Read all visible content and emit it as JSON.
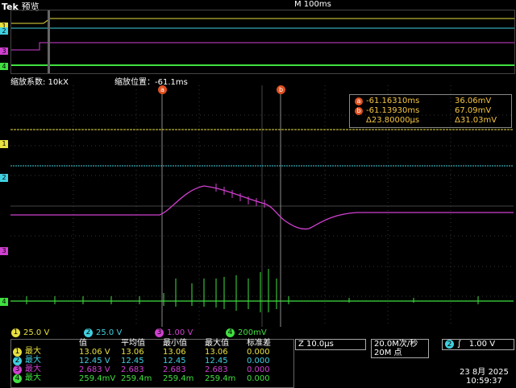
{
  "header": {
    "brand": "Tek",
    "mode": "预览",
    "timebase": "M 100ms"
  },
  "zoom": {
    "factor_label": "缩放系数: 10kX",
    "position_label": "缩放位置：-61.1ms"
  },
  "cursor_readout": {
    "a_time": "-61.16310ms",
    "a_volt": "36.06mV",
    "b_time": "-61.13930ms",
    "b_volt": "67.09mV",
    "delta_time": "Δ23.80000μs",
    "delta_volt": "Δ31.03mV",
    "a_label": "a",
    "b_label": "b"
  },
  "channels": [
    {
      "num": "1",
      "scale": "25.0 V",
      "color": "#e8e040"
    },
    {
      "num": "2",
      "scale": "25.0 V",
      "color": "#40d0e0"
    },
    {
      "num": "3",
      "scale": "1.00 V",
      "color": "#d040d0"
    },
    {
      "num": "4",
      "scale": "200mV",
      "color": "#40e040"
    }
  ],
  "measurements": {
    "headers": [
      "值",
      "平均值",
      "最小值",
      "最大值",
      "标准差"
    ],
    "rows": [
      {
        "ch": "1",
        "label": "最大",
        "value": "13.06 V",
        "mean": "13.06",
        "min": "13.06",
        "max": "13.06",
        "std": "0.000"
      },
      {
        "ch": "2",
        "label": "最大",
        "value": "12.45 V",
        "mean": "12.45",
        "min": "12.45",
        "max": "12.45",
        "std": "0.000"
      },
      {
        "ch": "3",
        "label": "最大",
        "value": "2.683 V",
        "mean": "2.683",
        "min": "2.683",
        "max": "2.683",
        "std": "0.000"
      },
      {
        "ch": "4",
        "label": "最大",
        "value": "259.4mV",
        "mean": "259.4m",
        "min": "259.4m",
        "max": "259.4m",
        "std": "0.000"
      }
    ]
  },
  "horizontal": {
    "zoom_time": "Z 10.0μs",
    "sample_rate": "20.0M次/秒",
    "points": "20M 点"
  },
  "trigger": {
    "channel": "2",
    "slope": "∫",
    "level": "1.00 V"
  },
  "datetime": {
    "date": "23 8月 2025",
    "time": "10:59:37"
  }
}
